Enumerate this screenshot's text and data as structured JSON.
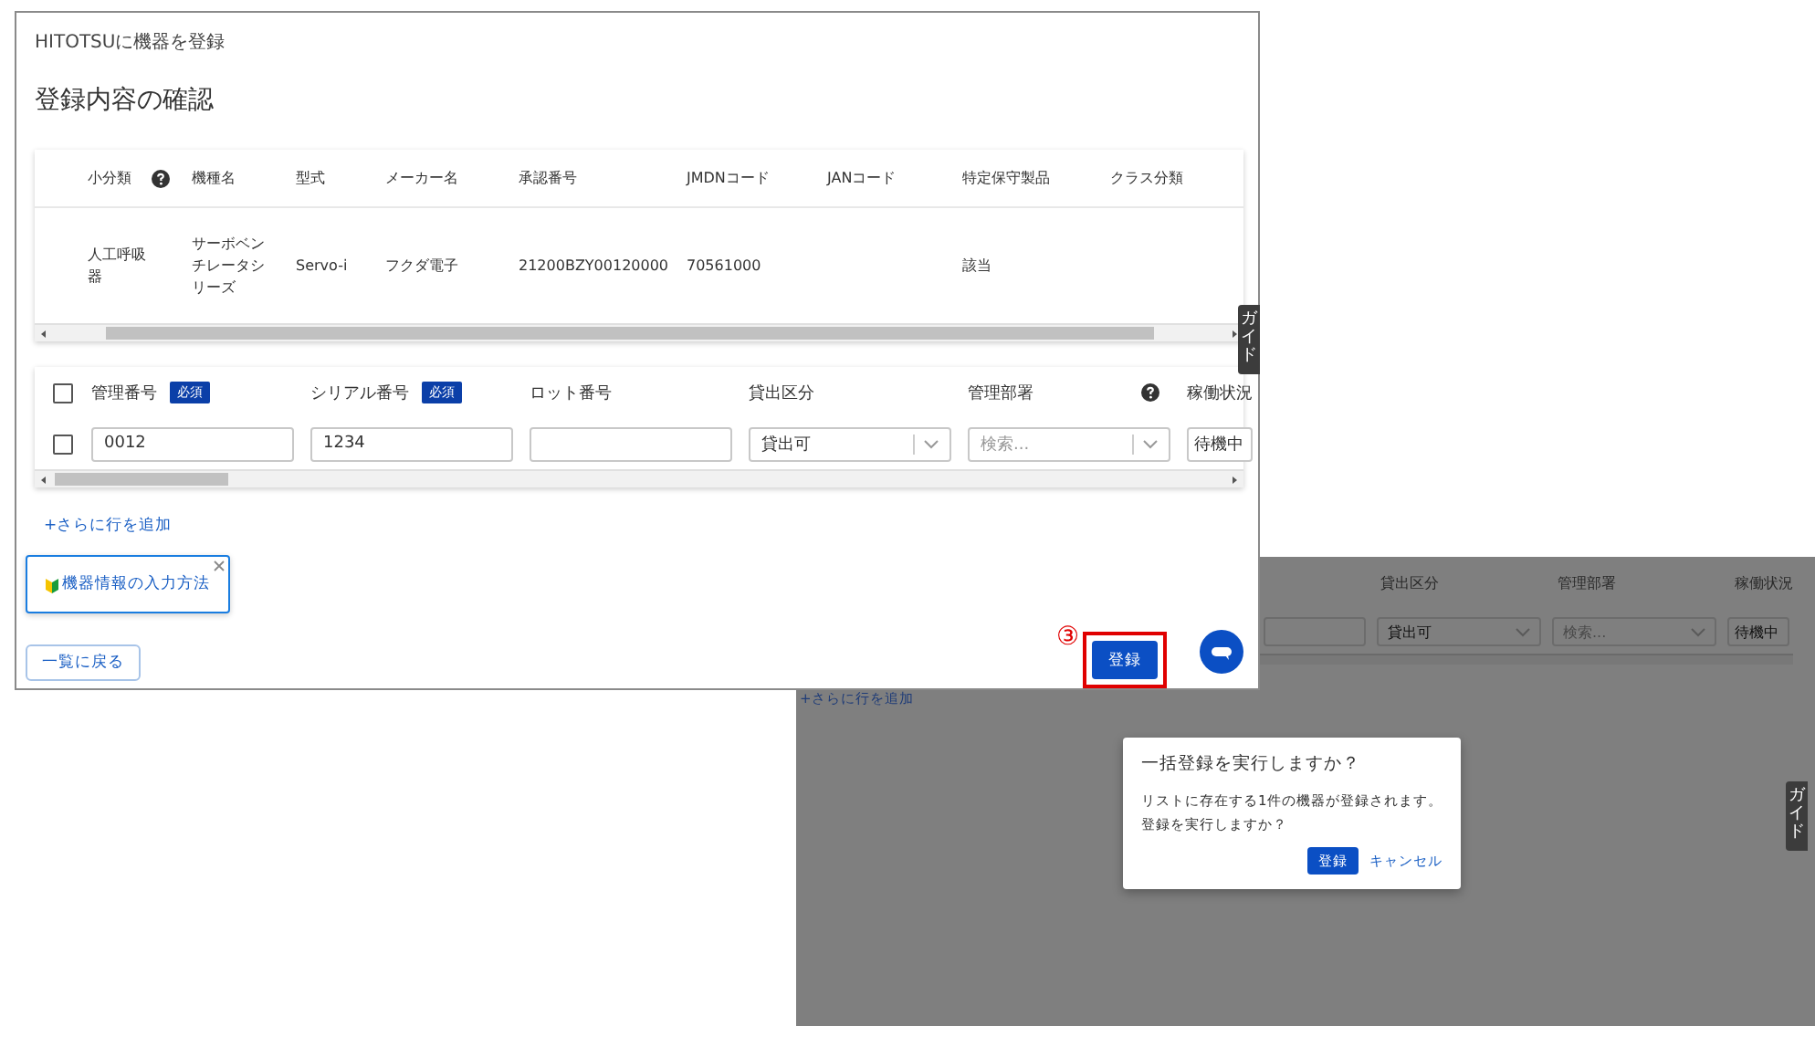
{
  "registration_window": {
    "title": "HITOTSUに機器を登録",
    "heading": "登録内容の確認",
    "device_table": {
      "columns": [
        {
          "label": "小分類",
          "help": true
        },
        {
          "label": "機種名"
        },
        {
          "label": "型式"
        },
        {
          "label": "メーカー名"
        },
        {
          "label": "承認番号"
        },
        {
          "label": "JMDNコード"
        },
        {
          "label": "JANコード"
        },
        {
          "label": "特定保守製品"
        },
        {
          "label": "クラス分類"
        }
      ],
      "rows": [
        {
          "cells": [
            {
              "text": "人工呼吸器"
            },
            {
              "text": "サーボベンチレータシリーズ"
            },
            {
              "text": "Servo-i"
            },
            {
              "text": "フクダ電子"
            },
            {
              "text": "21200BZY00120000"
            },
            {
              "text": "70561000"
            },
            {},
            {
              "text": "該当"
            },
            {}
          ]
        }
      ]
    },
    "entry_table": {
      "select_all_checked": false,
      "columns": [
        {
          "label": "管理番号",
          "required": "必須"
        },
        {
          "label": "シリアル番号",
          "required": "必須"
        },
        {
          "label": "ロット番号"
        },
        {
          "label": "貸出区分"
        },
        {
          "label": "管理部署",
          "help": true
        },
        {
          "label": "稼働状況"
        }
      ],
      "rows": [
        {
          "checked": false,
          "fields": [
            {
              "kind": "input",
              "value": "0012"
            },
            {
              "kind": "input",
              "value": "1234"
            },
            {
              "kind": "input"
            },
            {
              "kind": "select",
              "value": "貸出可"
            },
            {
              "kind": "select",
              "placeholder": "検索..."
            },
            {
              "kind": "select",
              "value": "待機中"
            }
          ]
        }
      ]
    },
    "add_row_link": "+さらに行を追加",
    "guide_card": {
      "label": "機器情報の入力方法"
    },
    "side_tab": "ガイド",
    "back_button": "一覧に戻る",
    "step_marker": "③",
    "register_button": {
      "label": "登録",
      "highlighted": true
    }
  },
  "confirm_screen": {
    "columns": [
      "貸出区分",
      "管理部署",
      "稼働状況"
    ],
    "fields": [
      {
        "kind": "input"
      },
      {
        "kind": "select",
        "value": "貸出可"
      },
      {
        "kind": "select",
        "placeholder": "検索..."
      },
      {
        "kind": "select",
        "value": "待機中"
      }
    ],
    "add_row_link": "+さらに行を追加",
    "side_tab": "ガイド",
    "dialog": {
      "title": "一括登録を実行しますか？",
      "message": [
        "リストに存在する1件の機器が登録されます。",
        "登録を実行しますか？"
      ],
      "confirm_button": "登録",
      "cancel_button": "キャンセル"
    }
  }
}
